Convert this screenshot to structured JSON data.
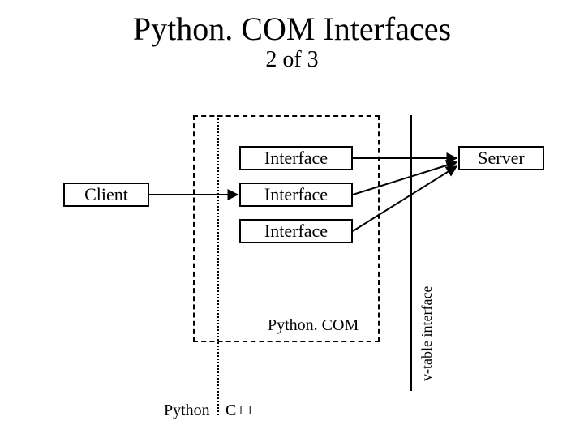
{
  "title": "Python. COM Interfaces",
  "subtitle": "2 of 3",
  "client": "Client",
  "server": "Server",
  "interfaces": [
    "Interface",
    "Interface",
    "Interface"
  ],
  "pythoncom_label": "Python. COM",
  "vtable_label": "v-table interface",
  "lang_left": "Python",
  "lang_right": "C++"
}
